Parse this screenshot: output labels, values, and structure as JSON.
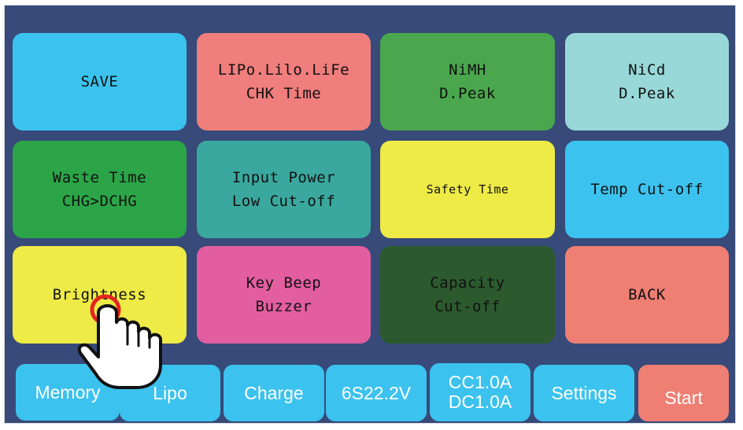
{
  "menu": {
    "tiles": [
      {
        "lines": [
          "SAVE"
        ],
        "color": "#3cc2ee"
      },
      {
        "lines": [
          "LIPo.Lilo.LiFe",
          "CHK Time"
        ],
        "color": "#ef7e7c"
      },
      {
        "lines": [
          "NiMH",
          "D.Peak"
        ],
        "color": "#4aa74d"
      },
      {
        "lines": [
          "NiCd",
          "D.Peak"
        ],
        "color": "#98d8d8"
      },
      {
        "lines": [
          "Waste Time",
          "CHG>DCHG"
        ],
        "color": "#2ba547"
      },
      {
        "lines": [
          "Input Power",
          "Low Cut-off"
        ],
        "color": "#3aa89e"
      },
      {
        "lines": [
          "Safety Time"
        ],
        "color": "#eeea46"
      },
      {
        "lines": [
          "Temp Cut-off"
        ],
        "color": "#3cc2ee"
      },
      {
        "lines": [
          "Brightness"
        ],
        "color": "#eeea46"
      },
      {
        "lines": [
          "Key Beep",
          "Buzzer"
        ],
        "color": "#e35da1"
      },
      {
        "lines": [
          "Capacity",
          "Cut-off"
        ],
        "color": "#2c5a2e"
      },
      {
        "lines": [
          "BACK"
        ],
        "color": "#ef7e73"
      }
    ]
  },
  "status_bar": {
    "items": [
      {
        "lines": [
          "Memory"
        ],
        "color": "#3cc2ee"
      },
      {
        "lines": [
          "Lipo"
        ],
        "color": "#3cc2ee"
      },
      {
        "lines": [
          "Charge"
        ],
        "color": "#3cc2ee"
      },
      {
        "lines": [
          "6S22.2V"
        ],
        "color": "#3cc2ee"
      },
      {
        "lines": [
          "CC1.0A",
          "DC1.0A"
        ],
        "color": "#3cc2ee"
      },
      {
        "lines": [
          "Settings"
        ],
        "color": "#3cc2ee"
      },
      {
        "lines": [
          "Start"
        ],
        "color": "#ef7e73"
      }
    ]
  },
  "overlay": {
    "icon": "hand-pointer-icon",
    "tap_ring_color": "#e52420"
  }
}
